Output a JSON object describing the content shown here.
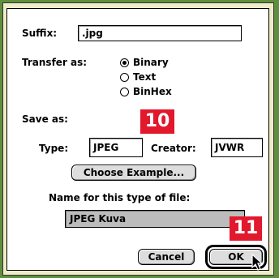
{
  "suffix": {
    "label": "Suffix:",
    "value": ".jpg"
  },
  "transfer": {
    "label": "Transfer as:",
    "options": [
      {
        "label": "Binary",
        "selected": true
      },
      {
        "label": "Text",
        "selected": false
      },
      {
        "label": "BinHex",
        "selected": false
      }
    ]
  },
  "save_as": {
    "label": "Save as:",
    "type_label": "Type:",
    "type_value": "JPEG",
    "creator_label": "Creator:",
    "creator_value": "JVWR",
    "choose_example_label": "Choose Example..."
  },
  "name": {
    "label": "Name for this type of file:",
    "value": "JPEG Kuva"
  },
  "buttons": {
    "cancel_label": "Cancel",
    "ok_label": "OK"
  },
  "badges": {
    "step_10": "10",
    "step_11": "11"
  },
  "colors": {
    "background": "#5f8f3e",
    "frame": "#eeedc8",
    "badge": "#e2182d",
    "selection": "#bcbcbc"
  }
}
